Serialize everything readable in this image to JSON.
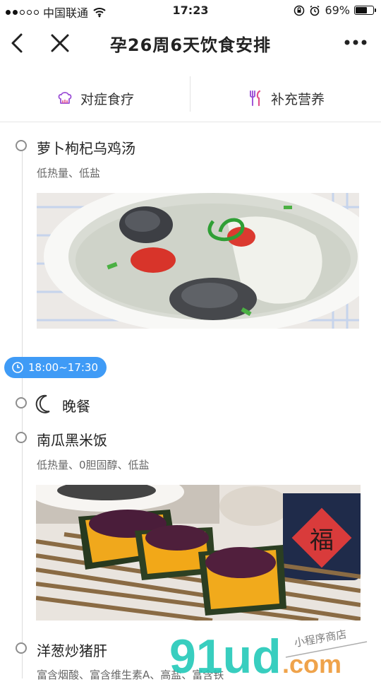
{
  "status": {
    "carrier": "中国联通",
    "time": "17:23",
    "battery": "69%",
    "battery_level": 0.69
  },
  "nav": {
    "title": "孕26周6天饮食安排"
  },
  "tabs": [
    {
      "label": "对症食疗",
      "icon": "chef-hat-icon"
    },
    {
      "label": "补充营养",
      "icon": "fork-knife-icon"
    }
  ],
  "items": [
    {
      "title": "萝卜枸杞乌鸡汤",
      "desc": "低热量、低盐"
    },
    {
      "title": "晚餐"
    },
    {
      "title": "南瓜黑米饭",
      "desc": "低热量、0胆固醇、低盐"
    },
    {
      "title": "洋葱炒猪肝",
      "desc": "富含烟酸、富含维生素A、高盐、富含铁"
    }
  ],
  "time_badge": "18:00~17:30",
  "photo_text": {
    "fu": "福"
  },
  "watermark": {
    "logo": "91ud",
    "domain": ".com",
    "tagline": "小程序商店"
  }
}
